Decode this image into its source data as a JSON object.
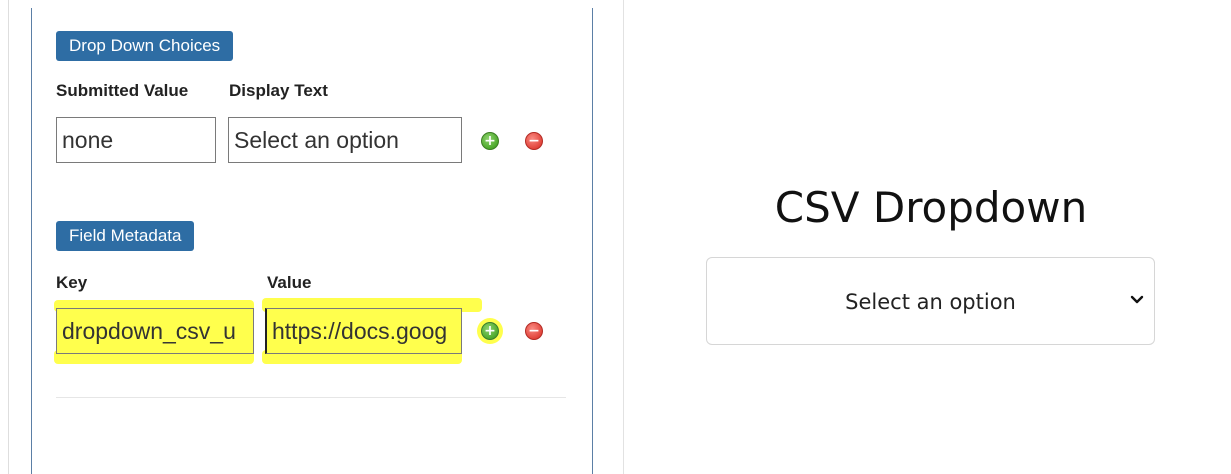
{
  "choices": {
    "badge": "Drop Down Choices",
    "submitted_header": "Submitted Value",
    "display_header": "Display Text",
    "row": {
      "submitted_value": "none",
      "display_text": "Select an option"
    }
  },
  "metadata": {
    "badge": "Field Metadata",
    "key_header": "Key",
    "value_header": "Value",
    "row": {
      "key": "dropdown_csv_u",
      "value": "https://docs.goog"
    }
  },
  "preview": {
    "title": "CSV Dropdown",
    "select": {
      "selected": "Select an option"
    }
  },
  "colors": {
    "badge": "#2e6da4",
    "highlight": "#ffff4d",
    "add": "#4da92c",
    "remove": "#e2453c"
  },
  "icons": {
    "add": "plus-circle-icon",
    "remove": "minus-circle-icon",
    "select": "chevron-down-icon"
  }
}
